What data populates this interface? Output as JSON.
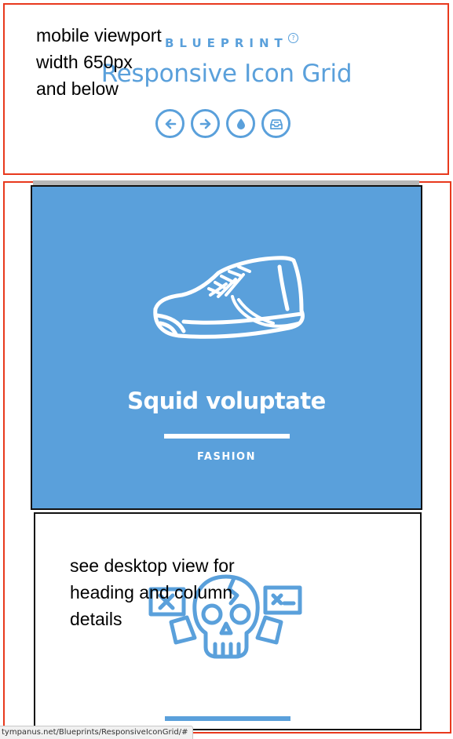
{
  "header": {
    "brand": "BLUEPRINT",
    "title": "Responsive Icon Grid",
    "nav_icons": [
      "arrow-left-icon",
      "arrow-right-icon",
      "drop-icon",
      "inbox-icon"
    ]
  },
  "annotations": {
    "mobile": "mobile viewport\nwidth 650px\nand below",
    "desktop": "see desktop view for\nheading and column\ndetails"
  },
  "cards": [
    {
      "title": "Squid voluptate",
      "category": "FASHION",
      "icon": "sneaker-icon"
    },
    {
      "icon": "skull-icon"
    }
  ],
  "status_bar": {
    "url": "tympanus.net/Blueprints/ResponsiveIconGrid/#"
  },
  "colors": {
    "accent": "#5aa0db",
    "annotation_red": "#e8391d",
    "card_border": "#111111"
  }
}
